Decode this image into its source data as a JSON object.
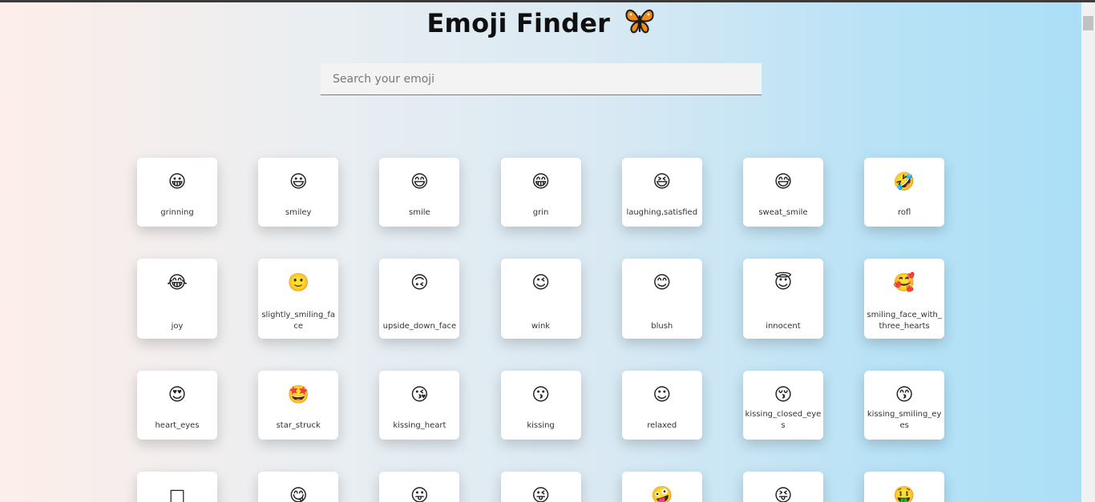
{
  "title": "Emoji Finder",
  "title_icon": "butterfly-icon",
  "search": {
    "placeholder": "Search your emoji",
    "value": ""
  },
  "emojis": [
    {
      "name": "grinning",
      "glyph": "😀"
    },
    {
      "name": "smiley",
      "glyph": "😃"
    },
    {
      "name": "smile",
      "glyph": "😄"
    },
    {
      "name": "grin",
      "glyph": "😁"
    },
    {
      "name": "laughing,satisfied",
      "glyph": "😆"
    },
    {
      "name": "sweat_smile",
      "glyph": "😅"
    },
    {
      "name": "rofl",
      "glyph": "🤣"
    },
    {
      "name": "joy",
      "glyph": "😂"
    },
    {
      "name": "slightly_smiling_face",
      "glyph": "🙂"
    },
    {
      "name": "upside_down_face",
      "glyph": "🙃"
    },
    {
      "name": "wink",
      "glyph": "😉"
    },
    {
      "name": "blush",
      "glyph": "😊"
    },
    {
      "name": "innocent",
      "glyph": "😇"
    },
    {
      "name": "smiling_face_with_three_hearts",
      "glyph": "🥰"
    },
    {
      "name": "heart_eyes",
      "glyph": "😍"
    },
    {
      "name": "star_struck",
      "glyph": "🤩"
    },
    {
      "name": "kissing_heart",
      "glyph": "😘"
    },
    {
      "name": "kissing",
      "glyph": "😗"
    },
    {
      "name": "relaxed",
      "glyph": "☺"
    },
    {
      "name": "kissing_closed_eyes",
      "glyph": "😚"
    },
    {
      "name": "kissing_smiling_eyes",
      "glyph": "😙"
    },
    {
      "name": "",
      "glyph": "□"
    },
    {
      "name": "",
      "glyph": "😋"
    },
    {
      "name": "",
      "glyph": "😛"
    },
    {
      "name": "",
      "glyph": "😜"
    },
    {
      "name": "",
      "glyph": "🤪"
    },
    {
      "name": "",
      "glyph": "😝"
    },
    {
      "name": "",
      "glyph": "🤑"
    }
  ]
}
